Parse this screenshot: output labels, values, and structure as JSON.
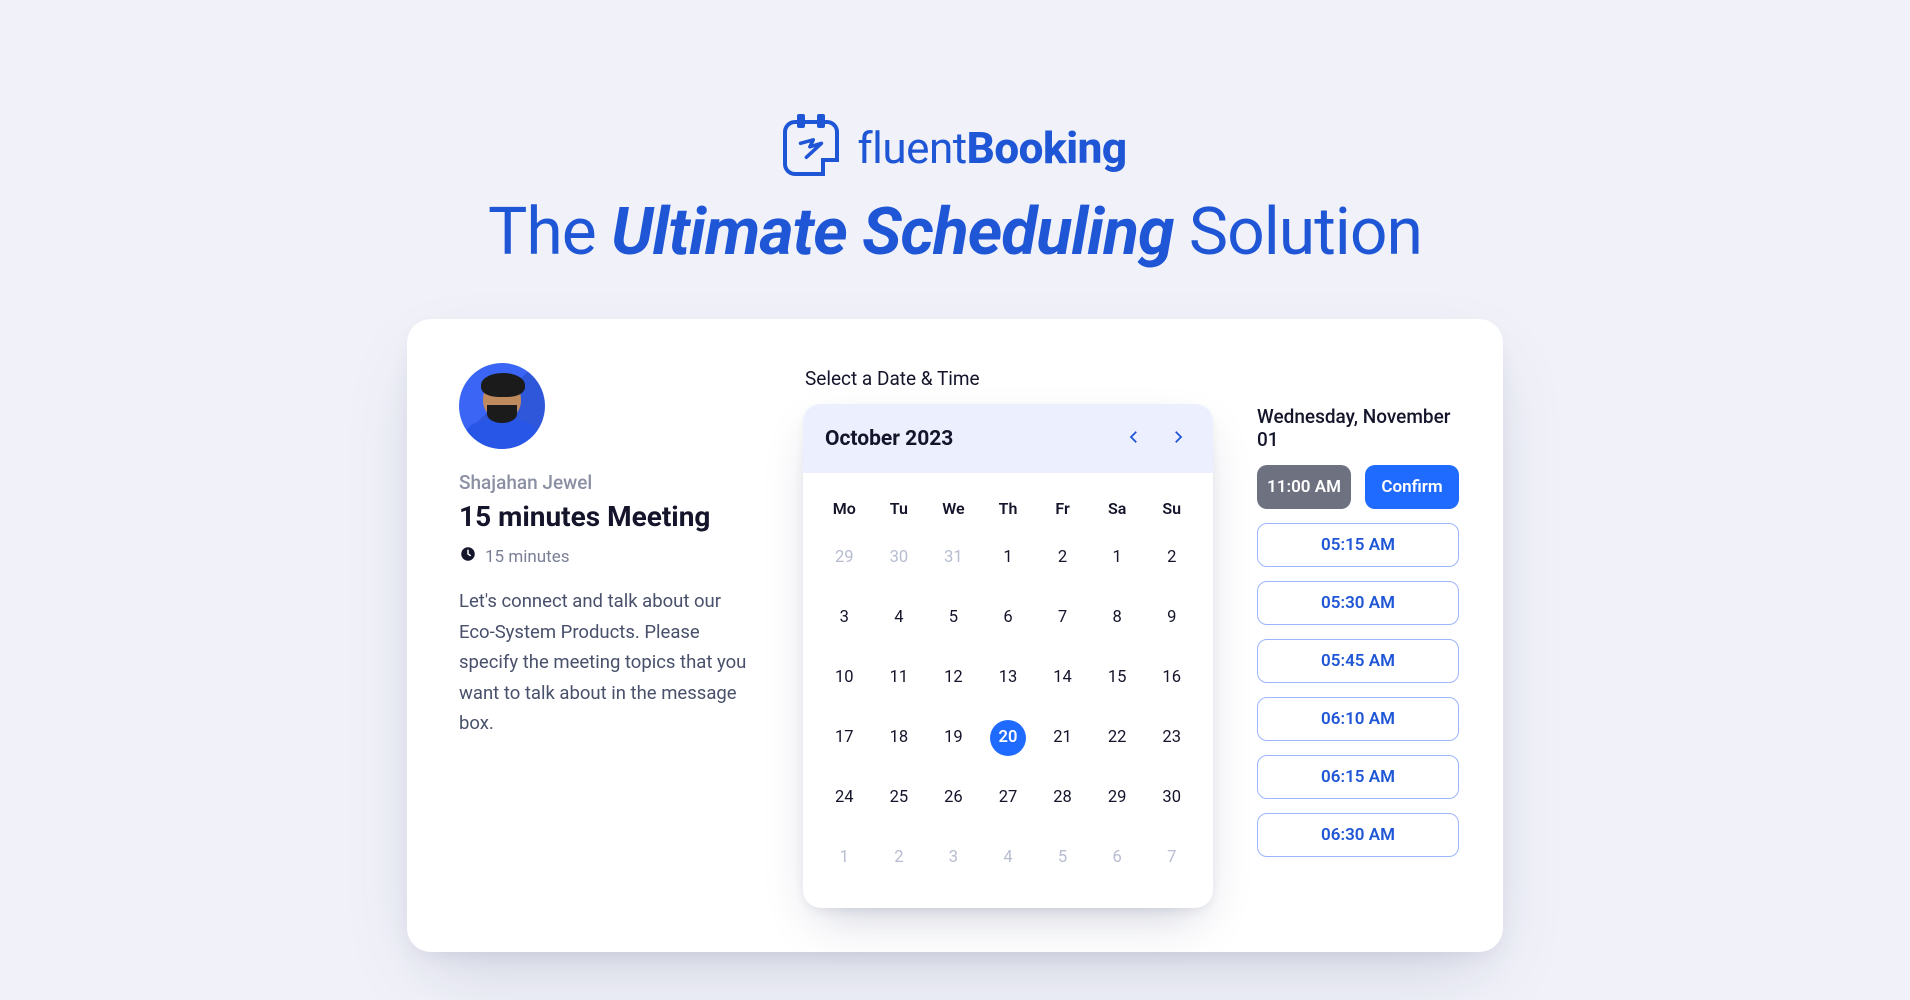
{
  "brand": {
    "name_light": "fluent",
    "name_bold": "Booking"
  },
  "headline": {
    "pre": "The ",
    "em": "Ultimate Scheduling",
    "post": " Solution"
  },
  "info": {
    "host": "Shajahan Jewel",
    "title": "15 minutes Meeting",
    "duration": "15 minutes",
    "description": "Let's connect and talk about our Eco-System Products. Please specify the meeting topics that you want to talk about in the message box."
  },
  "calendar": {
    "section_label": "Select a Date & Time",
    "month_label": "October 2023",
    "dow": [
      "Mo",
      "Tu",
      "We",
      "Th",
      "Fr",
      "Sa",
      "Su"
    ],
    "days": [
      {
        "n": "29",
        "muted": true
      },
      {
        "n": "30",
        "muted": true
      },
      {
        "n": "31",
        "muted": true
      },
      {
        "n": "1"
      },
      {
        "n": "2"
      },
      {
        "n": "1"
      },
      {
        "n": "2"
      },
      {
        "n": "3"
      },
      {
        "n": "4"
      },
      {
        "n": "5"
      },
      {
        "n": "6"
      },
      {
        "n": "7"
      },
      {
        "n": "8"
      },
      {
        "n": "9"
      },
      {
        "n": "10"
      },
      {
        "n": "11"
      },
      {
        "n": "12"
      },
      {
        "n": "13"
      },
      {
        "n": "14"
      },
      {
        "n": "15"
      },
      {
        "n": "16"
      },
      {
        "n": "17"
      },
      {
        "n": "18"
      },
      {
        "n": "19"
      },
      {
        "n": "20",
        "selected": true
      },
      {
        "n": "21"
      },
      {
        "n": "22"
      },
      {
        "n": "23"
      },
      {
        "n": "24"
      },
      {
        "n": "25"
      },
      {
        "n": "26"
      },
      {
        "n": "27"
      },
      {
        "n": "28"
      },
      {
        "n": "29"
      },
      {
        "n": "30"
      },
      {
        "n": "1",
        "muted": true
      },
      {
        "n": "2",
        "muted": true
      },
      {
        "n": "3",
        "muted": true
      },
      {
        "n": "4",
        "muted": true
      },
      {
        "n": "5",
        "muted": true
      },
      {
        "n": "6",
        "muted": true
      },
      {
        "n": "7",
        "muted": true
      }
    ]
  },
  "slots": {
    "selected_date": "Wednesday, November 01",
    "selected_time": "11:00 AM",
    "confirm_label": "Confirm",
    "available": [
      "05:15 AM",
      "05:30 AM",
      "05:45 AM",
      "06:10 AM",
      "06:15 AM",
      "06:30 AM"
    ]
  }
}
